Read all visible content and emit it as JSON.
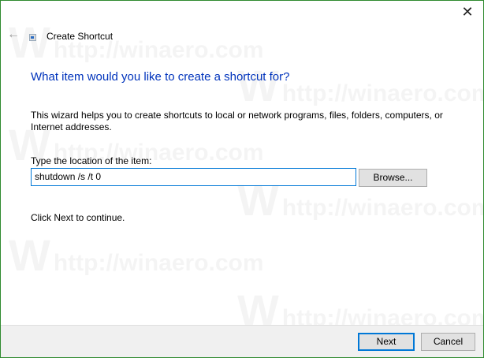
{
  "window": {
    "title": "Create Shortcut",
    "close_label": "✕",
    "back_label": "←"
  },
  "heading": "What item would you like to create a shortcut for?",
  "description": "This wizard helps you to create shortcuts to local or network programs, files, folders, computers, or Internet addresses.",
  "location": {
    "label": "Type the location of the item:",
    "value": "shutdown /s /t 0"
  },
  "browse_label": "Browse...",
  "hint": "Click Next to continue.",
  "footer": {
    "next_label": "Next",
    "cancel_label": "Cancel"
  },
  "watermark": {
    "letter": "W",
    "text": "http://winaero.com"
  }
}
